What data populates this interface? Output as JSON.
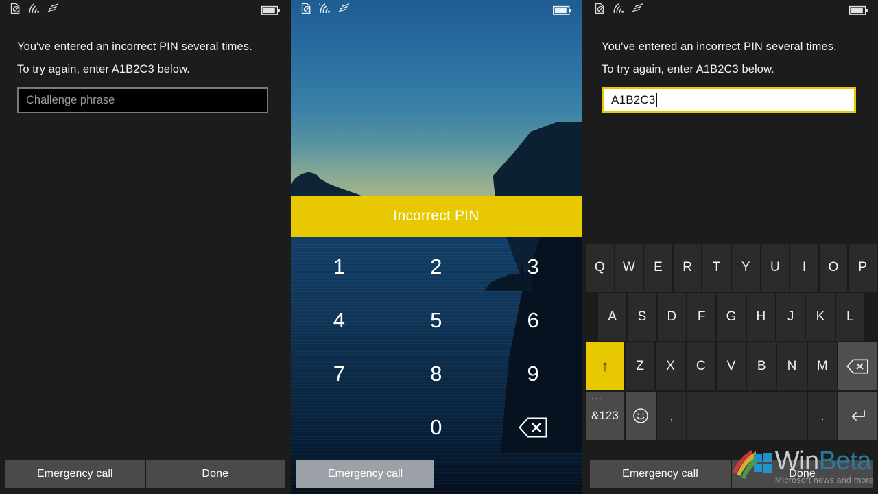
{
  "statusbar": {
    "icons": [
      {
        "name": "no-sim-icon",
        "glyph": "sim-off"
      },
      {
        "name": "wifi-icon",
        "glyph": "wifi"
      },
      {
        "name": "cellular-data-icon",
        "glyph": "data-waves"
      }
    ],
    "battery": {
      "name": "battery-icon",
      "level_pct": 85
    }
  },
  "colors": {
    "accent_yellow": "#e8c800",
    "panel_dark": "#1c1c1c",
    "button_gray": "#4a4a4a",
    "light_button_gray": "#9ca1a8",
    "key_gray": "#2b2b2b",
    "key_gray_alt": "#4a4a4a",
    "input_border_unfocused": "#7a7a7a",
    "text_primary": "#f2f2f2",
    "placeholder": "#9b9b9b"
  },
  "panel_left": {
    "message_line1": "You've entered an incorrect PIN several times.",
    "message_line2": "To try again, enter A1B2C3 below.",
    "input": {
      "placeholder": "Challenge phrase",
      "value": "",
      "focused": false
    },
    "appbar": [
      {
        "label": "Emergency call",
        "name": "emergency-call-button"
      },
      {
        "label": "Done",
        "name": "done-button"
      }
    ]
  },
  "panel_middle": {
    "banner_text": "Incorrect PIN",
    "numpad_keys": [
      {
        "label": "1",
        "name": "numpad-key-1"
      },
      {
        "label": "2",
        "name": "numpad-key-2"
      },
      {
        "label": "3",
        "name": "numpad-key-3"
      },
      {
        "label": "4",
        "name": "numpad-key-4"
      },
      {
        "label": "5",
        "name": "numpad-key-5"
      },
      {
        "label": "6",
        "name": "numpad-key-6"
      },
      {
        "label": "7",
        "name": "numpad-key-7"
      },
      {
        "label": "8",
        "name": "numpad-key-8"
      },
      {
        "label": "9",
        "name": "numpad-key-9"
      },
      {
        "label": "",
        "name": "numpad-key-blank"
      },
      {
        "label": "0",
        "name": "numpad-key-0"
      },
      {
        "label": "backspace-icon",
        "name": "numpad-backspace-key"
      }
    ],
    "appbar": [
      {
        "label": "Emergency call",
        "name": "emergency-call-button"
      }
    ]
  },
  "panel_right": {
    "message_line1": "You've entered an incorrect PIN several times.",
    "message_line2": "To try again, enter A1B2C3 below.",
    "input": {
      "placeholder": "Challenge phrase",
      "value": "A1B2C3",
      "focused": true
    },
    "keyboard": {
      "row1": [
        "Q",
        "W",
        "E",
        "R",
        "T",
        "Y",
        "U",
        "I",
        "O",
        "P"
      ],
      "row2": [
        "A",
        "S",
        "D",
        "F",
        "G",
        "H",
        "J",
        "K",
        "L"
      ],
      "row3_letters": [
        "Z",
        "X",
        "C",
        "V",
        "B",
        "N",
        "M"
      ],
      "shift_label": "↑",
      "backspace_label": "⌫",
      "sym_label": "&123",
      "sym_dots": "···",
      "emoji_label": "☺",
      "comma_label": ",",
      "space_label": "",
      "period_label": ".",
      "enter_label": "↵",
      "shift_active": true
    },
    "appbar": [
      {
        "label": "Emergency call",
        "name": "emergency-call-button"
      },
      {
        "label": "Done",
        "name": "done-button"
      }
    ]
  },
  "watermark": {
    "brand_first": "Win",
    "brand_second": "Beta",
    "tagline": "Microsoft news and more"
  }
}
